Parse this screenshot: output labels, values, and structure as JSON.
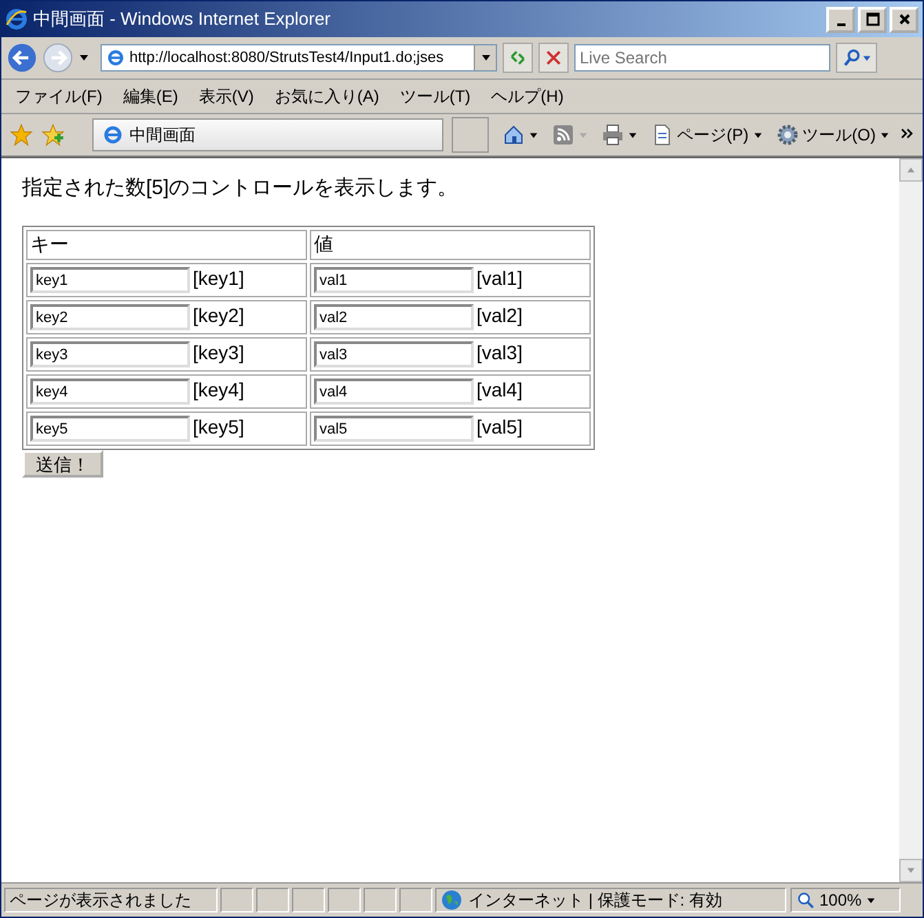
{
  "window": {
    "title": "中間画面 - Windows Internet Explorer"
  },
  "address_bar": {
    "url": "http://localhost:8080/StrutsTest4/Input1.do;jses"
  },
  "search": {
    "placeholder": "Live Search"
  },
  "menu": [
    "ファイル(F)",
    "編集(E)",
    "表示(V)",
    "お気に入り(A)",
    "ツール(T)",
    "ヘルプ(H)"
  ],
  "tab": {
    "title": "中間画面"
  },
  "command_bar": [
    "ページ(P)",
    "ツール(O)"
  ],
  "page": {
    "intro": "指定された数[5]のコントロールを表示します。",
    "columns": [
      "キー",
      "値"
    ],
    "rows": [
      {
        "key": "key1",
        "key_echo": "[key1]",
        "value": "val1",
        "value_echo": "[val1]"
      },
      {
        "key": "key2",
        "key_echo": "[key2]",
        "value": "val2",
        "value_echo": "[val2]"
      },
      {
        "key": "key3",
        "key_echo": "[key3]",
        "value": "val3",
        "value_echo": "[val3]"
      },
      {
        "key": "key4",
        "key_echo": "[key4]",
        "value": "val4",
        "value_echo": "[val4]"
      },
      {
        "key": "key5",
        "key_echo": "[key5]",
        "value": "val5",
        "value_echo": "[val5]"
      }
    ],
    "submit": "送信！"
  },
  "status_bar": {
    "message": "ページが表示されました",
    "zone": "インターネット | 保護モード: 有効",
    "zoom": "100%"
  }
}
